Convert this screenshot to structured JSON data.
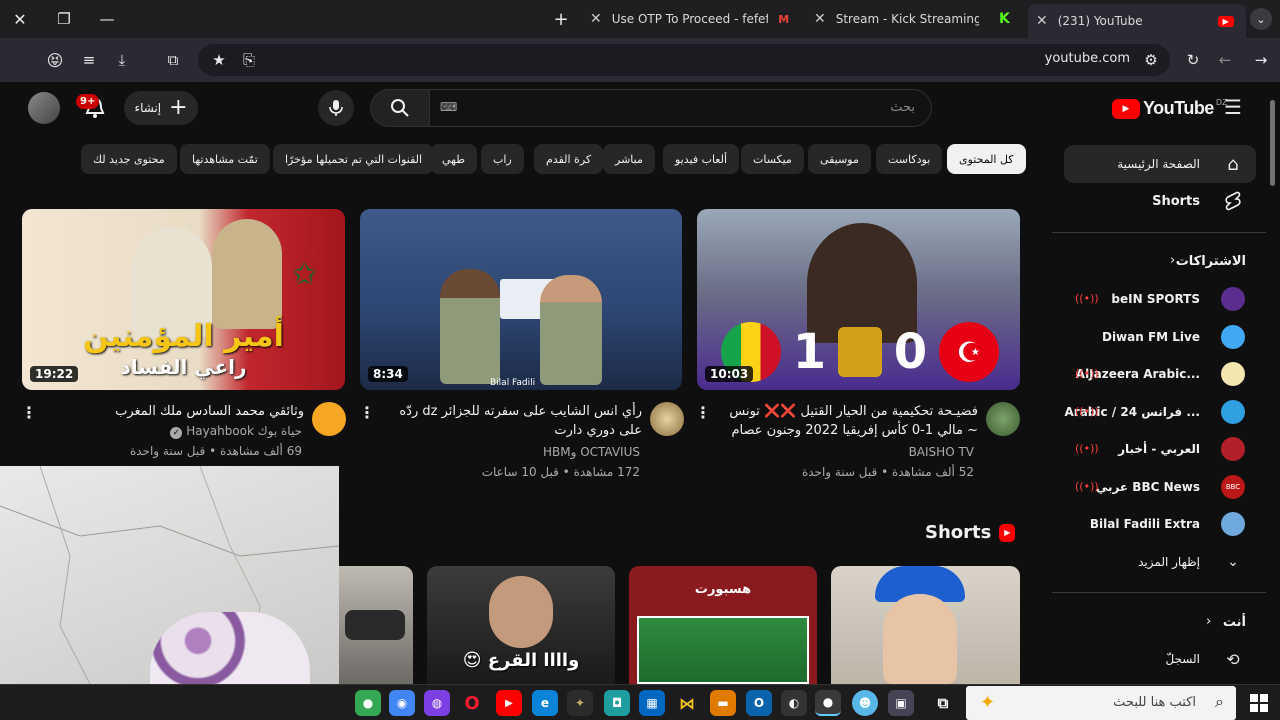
{
  "browser": {
    "tabs": [
      {
        "title": "Use OTP To Proceed - fefefezzd",
        "favicon": "gmail-icon"
      },
      {
        "title": "Stream - Kick Streaming",
        "favicon": "kick-icon"
      },
      {
        "title": "(231) YouTube",
        "favicon": "youtube-icon"
      }
    ],
    "url": "youtube.com"
  },
  "header": {
    "logo": "YouTube",
    "logo_country": "DZ",
    "search_placeholder": "بحث",
    "create_label": "إنشاء",
    "notif_count": "9+"
  },
  "chips": [
    "كل المحتوى",
    "بودكاست",
    "موسيقى",
    "ميكسات",
    "ألعاب فيديو",
    "مباشر",
    "كرة القدم",
    "راب",
    "طهي",
    "القنوات التي تم تحميلها مؤخرًا",
    "تمّت مشاهدتها",
    "محتوى جديد لك"
  ],
  "videos": [
    {
      "title": "فضيـحة تحكيمية من الحيار القتيل ❌❌ تونس ~ مالي 1-0 كأس إفريقيا 2022 وجنون عصام الشوال...",
      "channel": "BAISHO TV",
      "meta": "52 ألف مشاهدة • قبل سنة واحدة",
      "duration": "10:03",
      "score_left": "1",
      "score_right": "0"
    },
    {
      "title": "رأي انس الشايب على سفرته للجزائر dz ردّه على دوري دارت",
      "channel": "OCTAVIUS وHBM",
      "meta": "172 مشاهدة • قبل 10 ساعات",
      "duration": "8:34",
      "thumb_caption": "Bilal Fadili"
    },
    {
      "title": "وثائقي محمد السادس ملك المغرب",
      "channel": "حياة بوك Hayahbook",
      "meta": "69 ألف مشاهدة • قبل سنة واحدة",
      "duration": "19:22",
      "thumb_text_1": "أمير المؤمنين",
      "thumb_text_2": "راعي الفساد"
    }
  ],
  "shorts": {
    "heading": "Shorts",
    "items": [
      {
        "caption": ""
      },
      {
        "caption": "هسبورت"
      },
      {
        "caption": "واااا القرع 😍"
      },
      {
        "caption": ""
      }
    ]
  },
  "sidebar": {
    "home": "الصفحة الرئيسية",
    "shorts": "Shorts",
    "subs_heading": "الاشتراكات",
    "subs": [
      {
        "name": "beIN SPORTS",
        "live": true,
        "color": "#5b2d8e"
      },
      {
        "name": "Diwan FM Live",
        "live": false,
        "color": "#3fa9f5"
      },
      {
        "name": "AlJazeera Arabic...",
        "live": true,
        "color": "#d4a017"
      },
      {
        "name": "Arabic / 24 فرانس ...",
        "live": true,
        "color": "#2f9fe0"
      },
      {
        "name": "العربي - أخبار",
        "live": true,
        "color": "#b3202a"
      },
      {
        "name": "عربي BBC News",
        "live": true,
        "color": "#bb1919"
      },
      {
        "name": "Bilal Fadili Extra",
        "live": false,
        "color": "#6fa8dc"
      }
    ],
    "show_more": "إظهار المزيد",
    "you_heading": "أنت",
    "history": "السجلّ"
  },
  "taskbar": {
    "search_placeholder": "اكتب هنا للبحث"
  }
}
